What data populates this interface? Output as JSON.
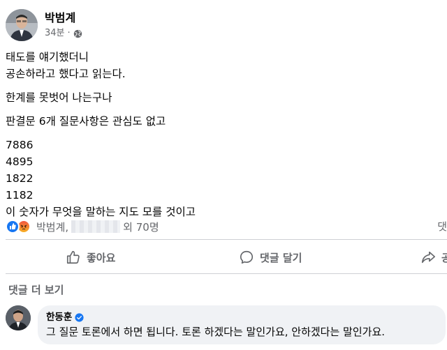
{
  "post": {
    "author": "박범계",
    "time": "34분",
    "dot": "·",
    "paragraphs": [
      [
        "태도를 얘기했더니",
        "공손하라고 했다고 읽는다."
      ],
      [
        "한계를 못벗어 나는구나"
      ],
      [
        "판결문 6개 질문사항은 관심도 없고"
      ],
      [
        "7886",
        "4895",
        "1822",
        "1182",
        "이 숫자가 무엇을 말하는 지도 모를 것이고"
      ]
    ]
  },
  "reactions": {
    "names_prefix": "박범계,",
    "count_text": "외 70명",
    "right_text": "댓"
  },
  "actions": {
    "like": "좋아요",
    "comment": "댓글 달기",
    "share": "공"
  },
  "more_comments": "댓글 더 보기",
  "comment": {
    "author": "한동훈",
    "text": "그 질문 토론에서 하면 됩니다. 토론 하겠다는 말인가요, 안하겠다는 말인가요."
  },
  "colors": {
    "accent": "#1877f2",
    "secondary_text": "#65676b",
    "bubble": "#f0f2f5"
  }
}
